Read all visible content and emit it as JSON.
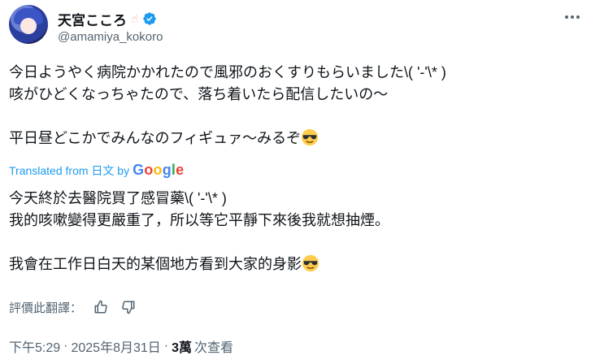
{
  "author": {
    "display_name": "天宮こころ",
    "handle": "@amamiya_kokoro"
  },
  "tweet": {
    "original_line1": "今日ようやく病院かかれたので風邪のおくすりもらいました\\( '-'\\* )",
    "original_line2": "咳がひどくなっちゃたので、落ち着いたら配信したいの〜",
    "original_line3": "平日昼どこかでみんなのフィギュァ〜みるぞ",
    "translated_from": "Translated from 日文 by",
    "translation_line1": "今天終於去醫院買了感冒藥\\( '-'\\* )",
    "translation_line2": "我的咳嗽變得更嚴重了，所以等它平靜下來後我就想抽煙。",
    "translation_line3": "我會在工作日白天的某個地方看到大家的身影"
  },
  "rate": {
    "label": "評價此翻譯："
  },
  "meta": {
    "time": "下午5:29",
    "date": "2025年8月31日",
    "views_count": "3萬",
    "views_label": "次查看"
  },
  "icons": {
    "verified": "verified-badge-icon",
    "more": "more-options-icon",
    "thumbs_up": "thumbs-up-icon",
    "thumbs_down": "thumbs-down-icon",
    "sunglasses": "sunglasses-emoji-icon"
  },
  "colors": {
    "accent": "#1d9bf0",
    "text": "#0f1419",
    "secondary": "#536471"
  }
}
